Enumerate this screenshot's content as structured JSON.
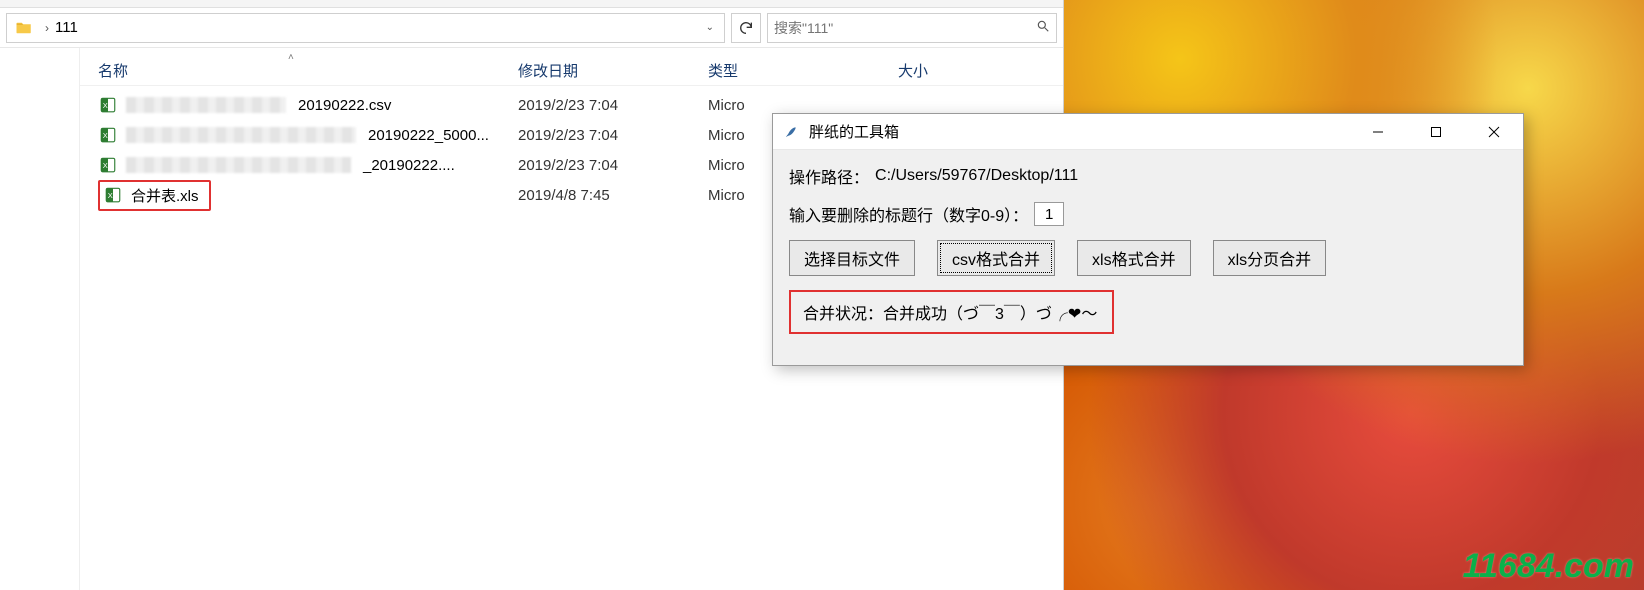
{
  "explorer": {
    "breadcrumb": "111",
    "search_placeholder": "搜索\"111\"",
    "columns": {
      "name": "名称",
      "date": "修改日期",
      "type": "类型",
      "size": "大小"
    },
    "files": [
      {
        "suffix": "20190222.csv",
        "date": "2019/2/23 7:04",
        "type": "Micro"
      },
      {
        "suffix": "20190222_5000...",
        "date": "2019/2/23 7:04",
        "type": "Micro"
      },
      {
        "suffix": "_20190222....",
        "date": "2019/2/23 7:04",
        "type": "Micro"
      },
      {
        "name": "合并表.xls",
        "date": "2019/4/8 7:45",
        "type": "Micro",
        "highlighted": true
      }
    ]
  },
  "tool": {
    "title": "胖纸的工具箱",
    "path_label": "操作路径：",
    "path_value": "C:/Users/59767/Desktop/111",
    "header_rows_label": "输入要删除的标题行（数字0-9）：",
    "header_rows_value": "1",
    "buttons": {
      "select": "选择目标文件",
      "csv_merge": "csv格式合并",
      "xls_merge": "xls格式合并",
      "xls_page_merge": "xls分页合并"
    },
    "status_label": "合并状况：",
    "status_value": "合并成功（づ￣3￣）づ╭❤～"
  },
  "watermark": "11684.com"
}
